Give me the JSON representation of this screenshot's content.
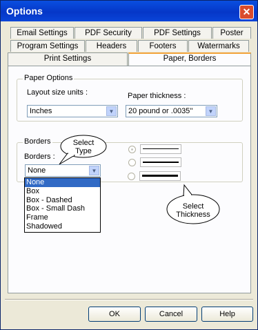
{
  "window": {
    "title": "Options",
    "close_label": "✕"
  },
  "tabs": {
    "row1": [
      "Email Settings",
      "PDF Security",
      "PDF Settings",
      "Poster"
    ],
    "row2": [
      "Program Settings",
      "Headers",
      "Footers",
      "Watermarks"
    ],
    "row3": [
      "Print Settings",
      "Paper, Borders"
    ],
    "active": "Paper, Borders"
  },
  "paper_options": {
    "legend": "Paper Options",
    "layout_label": "Layout size units :",
    "layout_value": "Inches",
    "thickness_label": "Paper thickness :",
    "thickness_value": "20 pound or .0035''"
  },
  "borders": {
    "legend": "Borders",
    "label": "Borders :",
    "value": "None",
    "options": [
      "None",
      "Box",
      "Box - Dashed",
      "Box - Small Dash",
      "Frame",
      "Shadowed"
    ],
    "selected_index": 0,
    "line_thickness_selected": 0
  },
  "callouts": {
    "select_type": "Select\nType",
    "select_thickness": "Select\nThickness"
  },
  "buttons": {
    "ok": "OK",
    "cancel": "Cancel",
    "help": "Help"
  }
}
